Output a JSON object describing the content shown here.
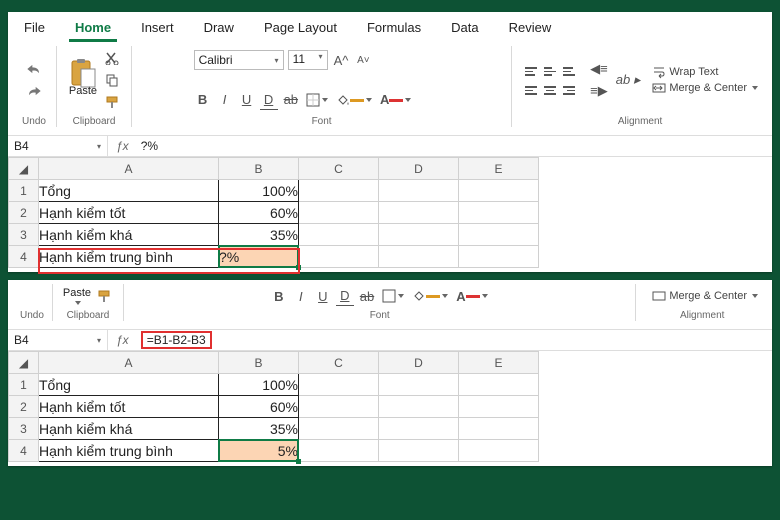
{
  "menu": [
    "File",
    "Home",
    "Insert",
    "Draw",
    "Page Layout",
    "Formulas",
    "Data",
    "Review"
  ],
  "menu_active": "Home",
  "ribbon": {
    "undo_label": "Undo",
    "clipboard_label": "Clipboard",
    "paste_label": "Paste",
    "font_label": "Font",
    "font_name": "Calibri",
    "font_size": "11",
    "alignment_label": "Alignment",
    "wrap_text": "Wrap Text",
    "merge_center": "Merge & Center"
  },
  "top": {
    "name_box": "B4",
    "formula": "?%",
    "columns": [
      "A",
      "B",
      "C",
      "D",
      "E"
    ],
    "rows": [
      {
        "n": "1",
        "a": "Tổng",
        "b": "100%"
      },
      {
        "n": "2",
        "a": "Hạnh kiểm tốt",
        "b": "60%"
      },
      {
        "n": "3",
        "a": "Hạnh kiểm khá",
        "b": "35%"
      },
      {
        "n": "4",
        "a": "Hạnh kiểm trung bình",
        "b": "?%"
      }
    ]
  },
  "bottom": {
    "name_box": "B4",
    "formula": "=B1-B2-B3",
    "columns": [
      "A",
      "B",
      "C",
      "D",
      "E"
    ],
    "rows": [
      {
        "n": "1",
        "a": "Tổng",
        "b": "100%"
      },
      {
        "n": "2",
        "a": "Hạnh kiểm tốt",
        "b": "60%"
      },
      {
        "n": "3",
        "a": "Hạnh kiểm khá",
        "b": "35%"
      },
      {
        "n": "4",
        "a": "Hạnh kiểm trung bình",
        "b": "5%"
      }
    ]
  }
}
